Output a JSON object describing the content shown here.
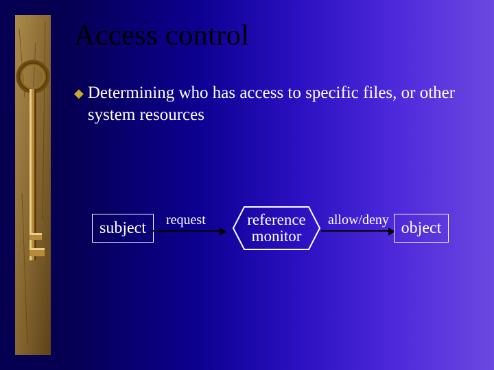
{
  "slide": {
    "title": "Access control",
    "bullet_marker": "◆",
    "bullet_text": "Determining who has access to specific files, or other system resources"
  },
  "diagram": {
    "subject_label": "subject",
    "request_label": "request",
    "monitor_line1": "reference",
    "monitor_line2": "monitor",
    "decision_label": "allow/deny",
    "object_label": "object"
  },
  "colors": {
    "bullet_accent": "#c8a832",
    "title_color": "#000000",
    "body_text": "#ffffff",
    "box_border": "#ffffff",
    "arrow_color": "#000000",
    "bg_gradient_start": "#050052",
    "bg_gradient_end": "#6c48e0"
  }
}
